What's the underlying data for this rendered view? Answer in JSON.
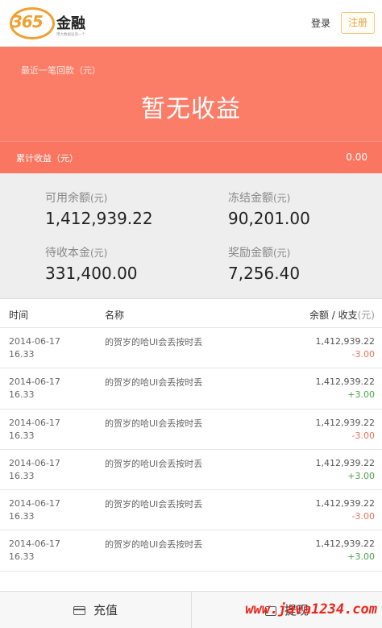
{
  "header": {
    "logo_number": "365",
    "logo_text": "金融",
    "logo_sub": "用大数据投资一个",
    "login_label": "登录",
    "register_label": "注册"
  },
  "hero": {
    "recent_label": "最近一笔回款（元）",
    "main_text": "暂无收益",
    "cumulative_label": "累计收益（元）",
    "cumulative_value": "0.00"
  },
  "balances": {
    "available": {
      "label": "可用余额",
      "unit": "(元)",
      "value": "1,412,939.22"
    },
    "frozen": {
      "label": "冻结金额",
      "unit": "(元)",
      "value": "90,201.00"
    },
    "pending": {
      "label": "待收本金",
      "unit": "(元)",
      "value": "331,400.00"
    },
    "reward": {
      "label": "奖励金额",
      "unit": "(元)",
      "value": "7,256.40"
    }
  },
  "table": {
    "headers": {
      "time": "时间",
      "name": "名称",
      "balance": "余额 / 收支",
      "unit": "(元)"
    },
    "rows": [
      {
        "date": "2014-06-17",
        "time": "16.33",
        "name": "的贺岁的哈UI会丢按时丢",
        "balance": "1,412,939.22",
        "change": "-3.00"
      },
      {
        "date": "2014-06-17",
        "time": "16.33",
        "name": "的贺岁的哈UI会丢按时丢",
        "balance": "1,412,939.22",
        "change": "+3.00"
      },
      {
        "date": "2014-06-17",
        "time": "16.33",
        "name": "的贺岁的哈UI会丢按时丢",
        "balance": "1,412,939.22",
        "change": "-3.00"
      },
      {
        "date": "2014-06-17",
        "time": "16.33",
        "name": "的贺岁的哈UI会丢按时丢",
        "balance": "1,412,939.22",
        "change": "+3.00"
      },
      {
        "date": "2014-06-17",
        "time": "16.33",
        "name": "的贺岁的哈UI会丢按时丢",
        "balance": "1,412,939.22",
        "change": "-3.00"
      },
      {
        "date": "2014-06-17",
        "time": "16.33",
        "name": "的贺岁的哈UI会丢按时丢",
        "balance": "1,412,939.22",
        "change": "+3.00"
      }
    ]
  },
  "bottom": {
    "recharge_label": "充值",
    "recharge_icon": "card-icon",
    "withdraw_label": "提现",
    "withdraw_icon": "withdraw-icon"
  },
  "watermark": "www.java1234.com",
  "colors": {
    "accent": "#fb7d67",
    "negative": "#e9715c",
    "positive": "#4aa34a",
    "register": "#e9a43d"
  }
}
